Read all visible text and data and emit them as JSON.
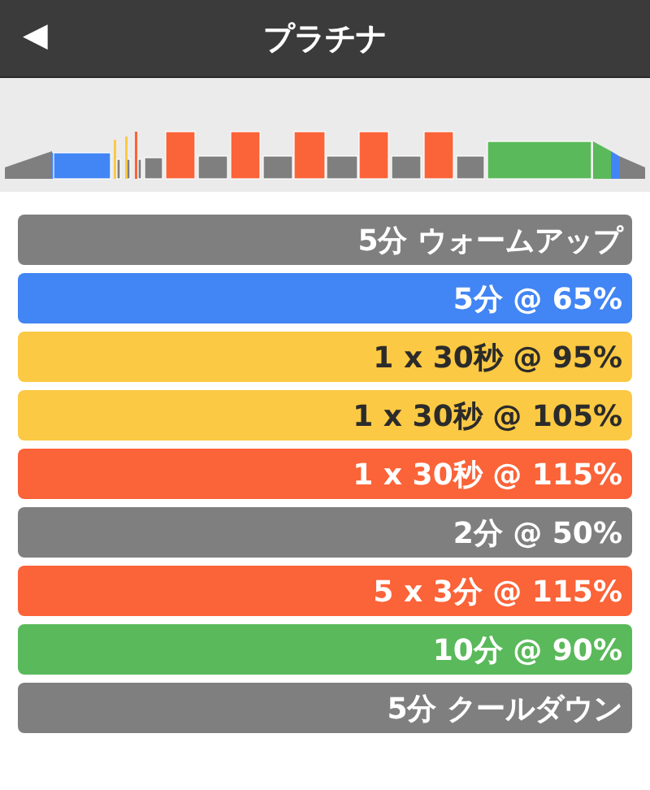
{
  "header": {
    "back_icon": "◀",
    "title": "プラチナ"
  },
  "intervals": [
    {
      "label": "5分 ウォームアップ",
      "color": "#7f7f7f"
    },
    {
      "label": "5分 @ 65%",
      "color": "#4285f4"
    },
    {
      "label": "1 x 30秒 @ 95%",
      "color": "#fbc943"
    },
    {
      "label": "1 x 30秒 @ 105%",
      "color": "#fbc943"
    },
    {
      "label": "1 x 30秒 @ 115%",
      "color": "#fb6338"
    },
    {
      "label": "2分 @ 50%",
      "color": "#7f7f7f"
    },
    {
      "label": "5 x 3分 @ 115%",
      "color": "#fb6338"
    },
    {
      "label": "10分 @ 90%",
      "color": "#5ab95a"
    },
    {
      "label": "5分 クールダウン",
      "color": "#7f7f7f"
    }
  ]
}
